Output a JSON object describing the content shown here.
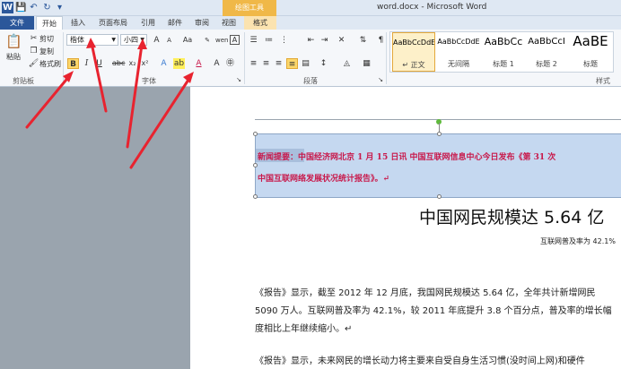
{
  "window": {
    "title": "word.docx - Microsoft Word",
    "context_tab_group": "绘图工具"
  },
  "quick_access": {
    "word_icon": "W",
    "save_icon": "💾",
    "undo_icon": "↶",
    "redo_icon": "↻",
    "more_icon": "▾"
  },
  "tabs": [
    {
      "label": "文件"
    },
    {
      "label": "开始"
    },
    {
      "label": "插入"
    },
    {
      "label": "页面布局"
    },
    {
      "label": "引用"
    },
    {
      "label": "邮件"
    },
    {
      "label": "审阅"
    },
    {
      "label": "视图"
    },
    {
      "label": "格式"
    }
  ],
  "clipboard": {
    "paste": "粘贴",
    "cut": "剪切",
    "copy": "复制",
    "format_painter": "格式刷",
    "group_label": "剪贴板"
  },
  "font": {
    "font_name": "楷体",
    "font_size": "小四",
    "group_label": "字体",
    "bold": "B",
    "italic": "I",
    "underline": "U",
    "grow": "A",
    "shrink": "A",
    "clear": "Aa",
    "pinyin": "wen",
    "border": "A"
  },
  "paragraph": {
    "group_label": "段落"
  },
  "styles": {
    "group_label": "样式",
    "items": [
      {
        "sample": "AaBbCcDdE",
        "name": "↵ 正文"
      },
      {
        "sample": "AaBbCcDdE",
        "name": "无间隔"
      },
      {
        "sample": "AaBbCc",
        "name": "标题 1"
      },
      {
        "sample": "AaBbCcI",
        "name": "标题 2"
      },
      {
        "sample": "AaBE",
        "name": "标题"
      }
    ]
  },
  "document": {
    "textbox_line1_highlight": "新闻提要：",
    "textbox_line1_rest": "中国经济网北京 1 月 15 日讯 中国互联网信息中心今日发布《第 31 次",
    "textbox_line2": "中国互联网络发展状况统计报告》。↵",
    "headline": "中国网民规模达 5.64 亿",
    "subheadline": "互联网普及率为 42.1%",
    "para1_line1": "《报告》显示，截至 2012 年 12 月底，我国网民规模达 5.64 亿，全年共计新增网民",
    "para1_line2": "5090 万人。互联网普及率为 42.1%，较 2011 年底提升 3.8 个百分点，普及率的增长幅",
    "para1_line3": "度相比上年继续缩小。↵",
    "para2_line1": "《报告》显示，未来网民的增长动力将主要来自受自身生活习惯(没时间上网)和硬件"
  }
}
